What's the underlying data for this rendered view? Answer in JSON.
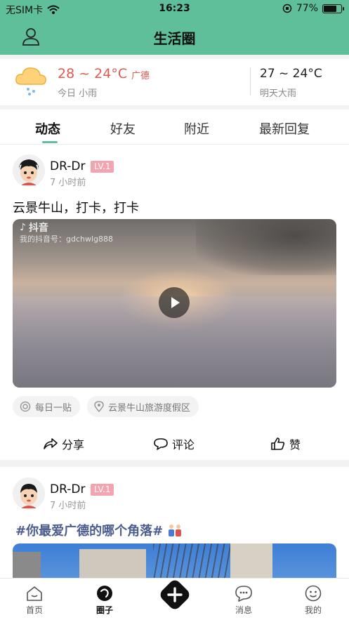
{
  "status_bar": {
    "carrier": "无SIM卡",
    "time": "16:23",
    "battery": "77%",
    "battery_level": 0.77
  },
  "navbar": {
    "title": "生活圈",
    "left_icon": "user-icon"
  },
  "weather": {
    "today_temp": "28 ~ 24°C",
    "city": "广德",
    "today_desc": "今日 小雨",
    "tomorrow_temp": "27 ~ 24°C",
    "tomorrow_desc": "明天大雨",
    "icon": "rain-cloud-icon"
  },
  "tabs": [
    {
      "label": "动态",
      "active": true
    },
    {
      "label": "好友",
      "active": false
    },
    {
      "label": "附近",
      "active": false
    },
    {
      "label": "最新回复",
      "active": false
    }
  ],
  "posts": [
    {
      "username": "DR-Dr",
      "level": "LV.1",
      "time": "7 小时前",
      "text": "云景牛山，打卡，打卡",
      "video_watermark_app": "抖音",
      "video_watermark_id": "我的抖音号：gdchwlg888",
      "tags": [
        "每日一贴",
        "云景牛山旅游度假区"
      ],
      "actions": {
        "share": "分享",
        "comment": "评论",
        "like": "赞"
      }
    },
    {
      "username": "DR-Dr",
      "level": "LV.1",
      "time": "7 小时前",
      "hashtag": "#你最爱广德的哪个角落#"
    }
  ],
  "bottom_nav": [
    {
      "label": "首页",
      "icon": "home-icon",
      "active": false
    },
    {
      "label": "圈子",
      "icon": "circle-icon",
      "active": true
    },
    {
      "label": "",
      "icon": "plus-icon",
      "active": false
    },
    {
      "label": "消息",
      "icon": "message-icon",
      "active": false
    },
    {
      "label": "我的",
      "icon": "profile-icon",
      "active": false
    }
  ],
  "colors": {
    "brand": "#5fbf9a",
    "temp_accent": "#e05a4e",
    "badge": "#f3a4b0",
    "hashtag": "#4a5d8e"
  }
}
